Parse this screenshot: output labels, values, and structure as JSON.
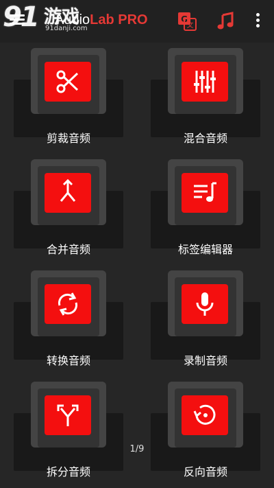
{
  "appbar": {
    "title_part1": "Audio",
    "title_part2": "Lab PRO",
    "icons": [
      "menu-icon",
      "translate-icon",
      "music-note-icon",
      "more-vert-icon"
    ],
    "accent_color": "#e53935"
  },
  "watermark": {
    "number": "91",
    "text": "游戏",
    "url": "91danji.com"
  },
  "tools": [
    {
      "label": "剪裁音频",
      "icon": "scissors-icon"
    },
    {
      "label": "混合音频",
      "icon": "equalizer-icon"
    },
    {
      "label": "合并音频",
      "icon": "merge-icon"
    },
    {
      "label": "标签编辑器",
      "icon": "playlist-music-icon"
    },
    {
      "label": "转换音频",
      "icon": "sync-icon"
    },
    {
      "label": "录制音频",
      "icon": "microphone-icon"
    },
    {
      "label": "拆分音频",
      "icon": "split-icon"
    },
    {
      "label": "反向音频",
      "icon": "reverse-icon"
    }
  ],
  "pager": {
    "text": "1/9"
  },
  "colors": {
    "icon_bg": "#f40f0f",
    "background": "#262626"
  }
}
